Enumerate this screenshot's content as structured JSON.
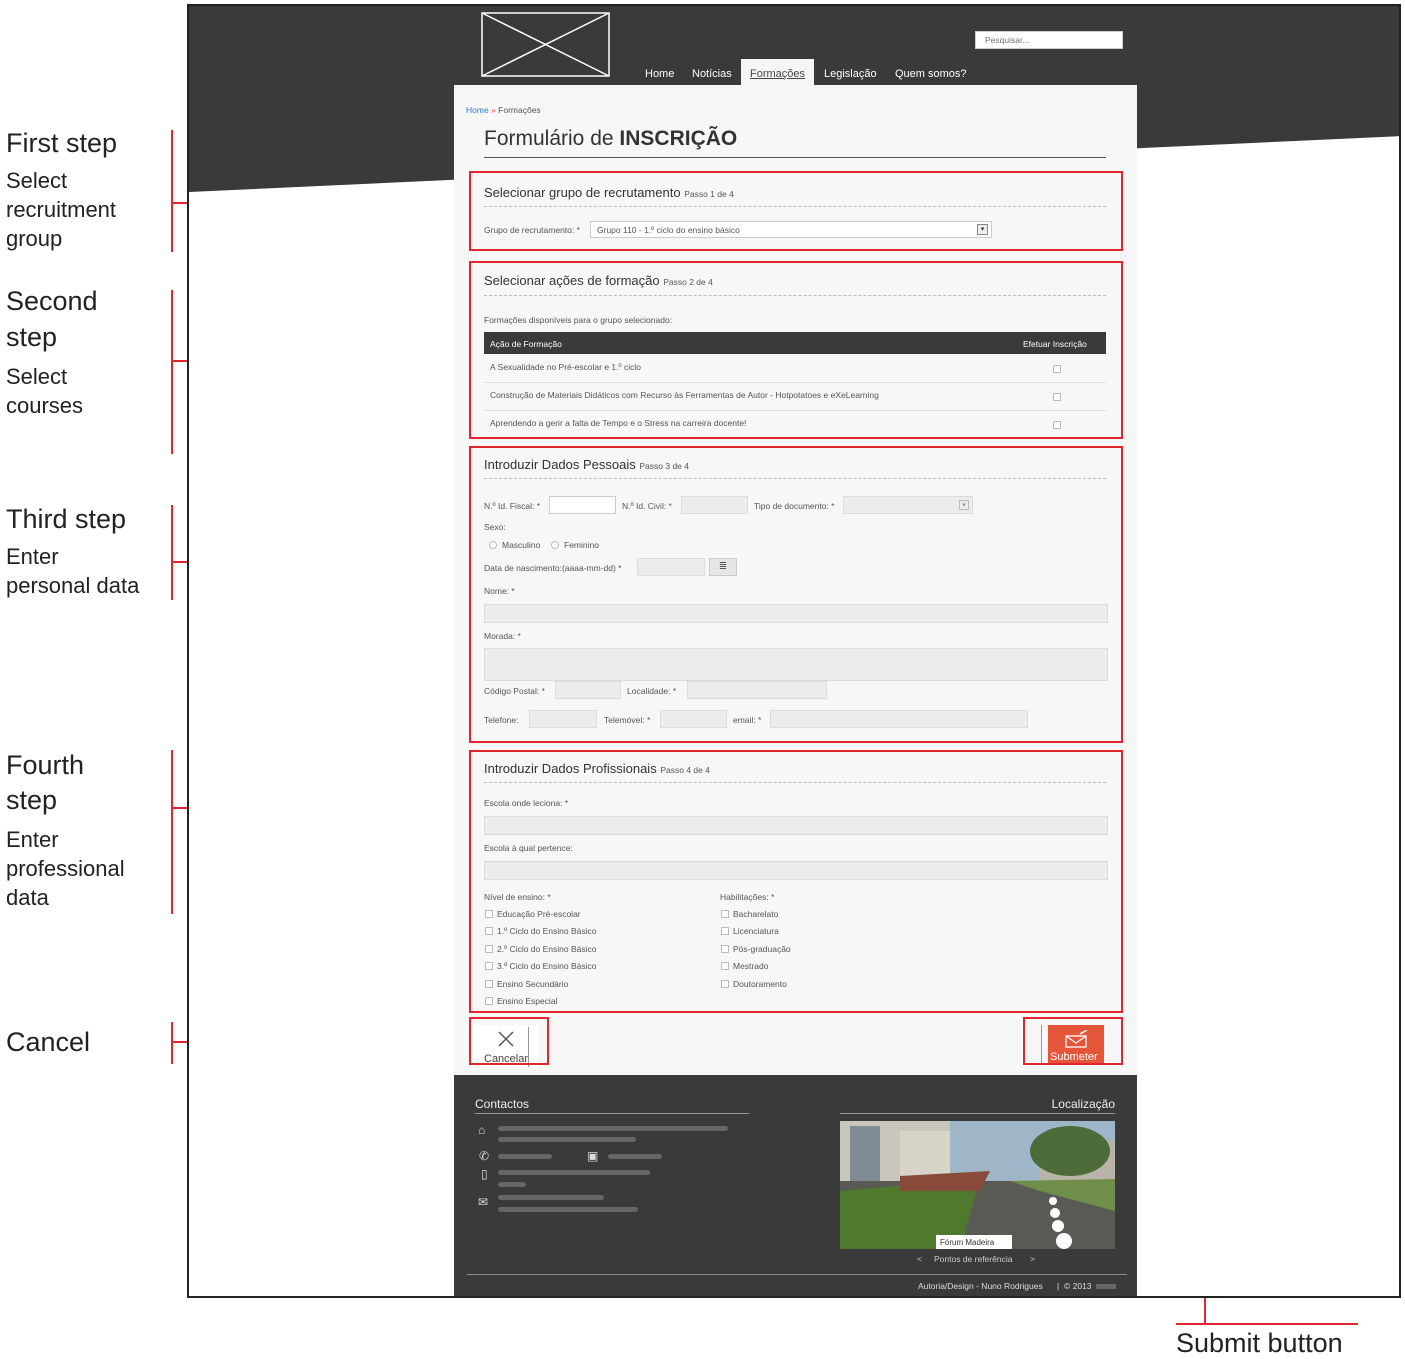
{
  "annotations": {
    "step1": {
      "title": "First step",
      "lines": [
        "Select",
        "recruitment",
        "group"
      ]
    },
    "step2": {
      "title_lines": [
        "Second",
        "step"
      ],
      "lines": [
        "Select",
        "courses"
      ]
    },
    "step3": {
      "title": "Third step",
      "lines": [
        "Enter",
        "personal data"
      ]
    },
    "step4": {
      "title_lines": [
        "Fourth",
        "step"
      ],
      "lines": [
        "Enter",
        "professional",
        "data"
      ]
    },
    "cancel": "Cancel",
    "submit": "Submit button"
  },
  "header": {
    "search_placeholder": "Pesquisar...",
    "nav": [
      "Home",
      "Notícias",
      "Formações",
      "Legislação",
      "Quem somos?"
    ],
    "active_nav": "Formações"
  },
  "breadcrumb": {
    "home": "Home",
    "sep": "»",
    "current": "Formações"
  },
  "form_title": {
    "prefix": "Formulário de ",
    "strong": "INSCRIÇÃO"
  },
  "step1": {
    "title": "Selecionar grupo de recrutamento",
    "step": "Passo 1 de 4",
    "label": "Grupo de recrutamento: *",
    "value": "Grupo 110 - 1.º ciclo do ensino básico"
  },
  "step2": {
    "title": "Selecionar ações de formação",
    "step": "Passo 2 de 4",
    "intro": "Formações disponíveis para o grupo selecionado:",
    "table_headers": [
      "Ação de Formação",
      "Efetuar Inscrição"
    ],
    "rows": [
      "A Sexualidade no Pré-escolar e 1.º ciclo",
      "Construção de Materiais Didáticos com Recurso às Ferramentas de Autor - Hotpotatoes e eXeLearning",
      "Aprendendo a gerir a falta de Tempo e o Stress na carreira docente!"
    ]
  },
  "step3": {
    "title": "Introduzir Dados Pessoais",
    "step": "Passo 3 de 4",
    "nif": "N.º Id. Fiscal: *",
    "nic": "N.º Id. Civil: *",
    "doc_type": "Tipo de documento: *",
    "sexo": "Sexo:",
    "masculino": "Masculino",
    "feminino": "Feminino",
    "birth": "Data de nascimento:(aaaa-mm-dd) *",
    "nome": "Nome: *",
    "morada": "Morada: *",
    "codigo_postal": "Código Postal: *",
    "localidade": "Localidade: *",
    "telefone": "Telefone:",
    "telemovel": "Telemóvel: *",
    "email": "email: *"
  },
  "step4": {
    "title": "Introduzir Dados Profissionais",
    "step": "Passo 4 de 4",
    "escola_leciona": "Escola onde leciona: *",
    "escola_pertence": "Escola à qual pertence:",
    "nivel_label": "Nível de ensino: *",
    "niveis": [
      "Educação Pré-escolar",
      "1.º Ciclo do Ensino Básico",
      "2.º Ciclo do Ensino Básico",
      "3.º Ciclo do Ensino Básico",
      "Ensino Secundário",
      "Ensino Especial"
    ],
    "hab_label": "Habilitações: *",
    "habilitacoes": [
      "Bacharelato",
      "Licenciatura",
      "Pós-graduação",
      "Mestrado",
      "Doutoramento"
    ]
  },
  "buttons": {
    "cancel": "Cancelar",
    "submit": "Submeter"
  },
  "footer": {
    "contactos": "Contactos",
    "localizacao": "Localização",
    "map_label": "Fórum Madeira",
    "map_nav": "Pontos de referência",
    "prev": "<",
    "next": ">",
    "credits": "Autoria/Design - Nuno Rodrigues",
    "copyright": "© 2013"
  },
  "colors": {
    "accent_red": "#e2262f",
    "submit_orange": "#e4553a",
    "dark": "#3a3a3a"
  }
}
